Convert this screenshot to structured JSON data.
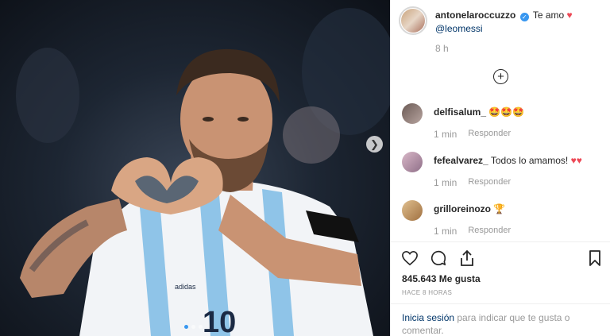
{
  "post": {
    "username": "antonelaroccuzzo",
    "caption": "Te amo",
    "mention": "@leomessi",
    "time": "8 h"
  },
  "comments": [
    {
      "user": "delfisalum_",
      "text": "",
      "emoji": "🤩🤩🤩",
      "time": "1 min",
      "reply": "Responder"
    },
    {
      "user": "fefealvarez_",
      "text": "Todos lo amamos!",
      "emoji": "♥♥",
      "time": "1 min",
      "reply": "Responder"
    },
    {
      "user": "grilloreinozo",
      "text": "",
      "emoji": "🏆",
      "time": "1 min",
      "reply": "Responder"
    }
  ],
  "stats": {
    "likes": "845.643 Me gusta",
    "time_ago": "HACE 8 HORAS"
  },
  "login": {
    "link": "Inicia sesión",
    "rest": " para indicar que te gusta o comentar."
  },
  "media": {
    "description_icon": "photo",
    "dots": 3,
    "active_dot": 0
  },
  "colors": {
    "accent": "#3897f0",
    "heart": "#ed4956",
    "link": "#003569"
  }
}
